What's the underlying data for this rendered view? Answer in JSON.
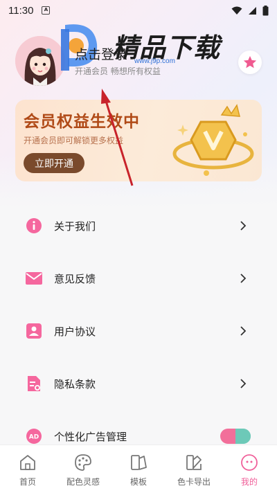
{
  "status_bar": {
    "time": "11:30",
    "app_icon": "A"
  },
  "profile": {
    "login_title": "点击登录",
    "login_subtitle": "开通会员 畅想所有权益"
  },
  "watermark": {
    "text": "精品下载",
    "url": "www.j9p.com"
  },
  "vip_card": {
    "title": "会员权益生效中",
    "subtitle": "开通会员即可解锁更多权益",
    "button": "立即开通"
  },
  "menu": {
    "items": [
      {
        "label": "关于我们",
        "icon": "info-icon"
      },
      {
        "label": "意见反馈",
        "icon": "mail-icon"
      },
      {
        "label": "用户协议",
        "icon": "user-icon"
      },
      {
        "label": "隐私条款",
        "icon": "document-icon"
      },
      {
        "label": "个性化广告管理",
        "icon": "ad-icon"
      }
    ]
  },
  "bottom_nav": {
    "items": [
      {
        "label": "首页",
        "icon": "home-icon"
      },
      {
        "label": "配色灵感",
        "icon": "palette-icon"
      },
      {
        "label": "模板",
        "icon": "template-icon"
      },
      {
        "label": "色卡导出",
        "icon": "color-card-icon"
      },
      {
        "label": "我的",
        "icon": "profile-icon"
      }
    ],
    "active": "我的"
  },
  "colors": {
    "accent": "#f0609a",
    "vip_text": "#b04a17",
    "vip_button": "#7a4a2c",
    "toggle_on": "#6dc9b8"
  }
}
